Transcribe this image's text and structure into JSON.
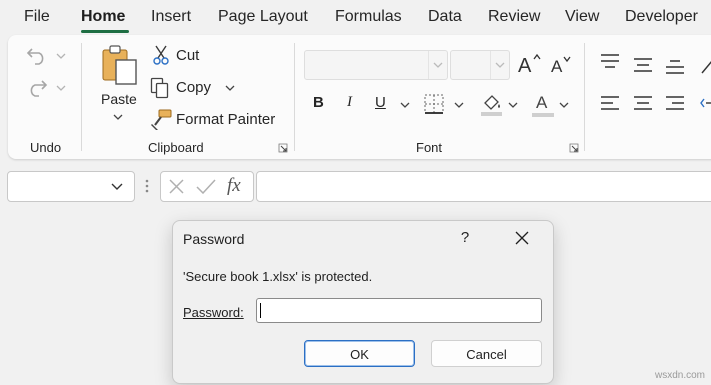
{
  "tabs": [
    "File",
    "Home",
    "Insert",
    "Page Layout",
    "Formulas",
    "Data",
    "Review",
    "View",
    "Developer"
  ],
  "active_tab": "Home",
  "ribbon": {
    "undo_group": {
      "label": "Undo"
    },
    "clipboard_group": {
      "label": "Clipboard",
      "paste_label": "Paste",
      "cut_label": "Cut",
      "copy_label": "Copy",
      "format_painter_label": "Format Painter"
    },
    "font_group": {
      "label": "Font",
      "font_name": "",
      "font_size": "",
      "bold_icon": "B",
      "italic_icon": "I",
      "underline_icon": "U",
      "font_color_icon": "A"
    }
  },
  "formula_bar": {
    "name_box": "",
    "fx_label": "fx",
    "formula": ""
  },
  "dialog": {
    "title": "Password",
    "help_label": "?",
    "message": "'Secure book 1.xlsx' is protected.",
    "password_label": "Password:",
    "password_value": "",
    "ok_label": "OK",
    "cancel_label": "Cancel"
  },
  "watermark": "wsxdn.com",
  "colors": {
    "accent_green": "#1e6e43",
    "ok_button_border": "#2b6fc4"
  },
  "icons": [
    "undo-icon",
    "redo-icon",
    "paste-icon",
    "cut-icon",
    "copy-icon",
    "format-painter-icon",
    "increase-font-icon",
    "decrease-font-icon",
    "border-icon",
    "fill-color-icon",
    "font-color-icon",
    "align-icons",
    "cancel-x-icon",
    "check-icon",
    "close-icon"
  ]
}
